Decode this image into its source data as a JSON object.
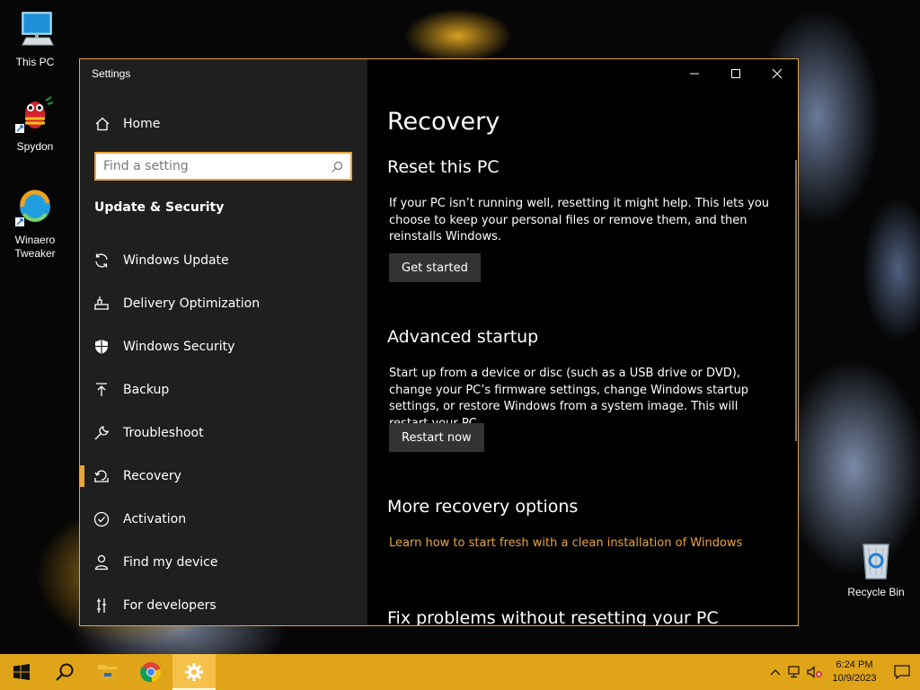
{
  "desktop": {
    "icons": [
      {
        "label": "This PC"
      },
      {
        "label": "Spydon"
      },
      {
        "label": "Winaero Tweaker"
      },
      {
        "label": "Recycle Bin"
      }
    ]
  },
  "window": {
    "title": "Settings",
    "controls": {
      "minimize": "minimize-icon",
      "maximize": "maximize-icon",
      "close": "close-icon"
    },
    "accent": "#e8a53c"
  },
  "sidebar": {
    "home_label": "Home",
    "search": {
      "placeholder": "Find a setting"
    },
    "section_title": "Update & Security",
    "items": [
      {
        "label": "Windows Update",
        "icon": "refresh-icon"
      },
      {
        "label": "Delivery Optimization",
        "icon": "delivery-optimization-icon"
      },
      {
        "label": "Windows Security",
        "icon": "shield-icon"
      },
      {
        "label": "Backup",
        "icon": "backup-arrow-icon"
      },
      {
        "label": "Troubleshoot",
        "icon": "wrench-icon"
      },
      {
        "label": "Recovery",
        "icon": "recovery-icon",
        "active": true
      },
      {
        "label": "Activation",
        "icon": "check-circle-icon"
      },
      {
        "label": "Find my device",
        "icon": "person-location-icon"
      },
      {
        "label": "For developers",
        "icon": "developer-tools-icon"
      }
    ]
  },
  "content": {
    "title": "Recovery",
    "reset": {
      "heading": "Reset this PC",
      "text": "If your PC isn’t running well, resetting it might help. This lets you choose to keep your personal files or remove them, and then reinstalls Windows.",
      "button": "Get started"
    },
    "advanced": {
      "heading": "Advanced startup",
      "text": "Start up from a device or disc (such as a USB drive or DVD), change your PC’s firmware settings, change Windows startup settings, or restore Windows from a system image. This will restart your PC.",
      "button": "Restart now"
    },
    "more": {
      "heading": "More recovery options",
      "link": "Learn how to start fresh with a clean installation of Windows"
    },
    "fix": {
      "heading": "Fix problems without resetting your PC"
    }
  },
  "taskbar": {
    "color": "#e0a418",
    "apps": [
      "start-icon",
      "search-icon",
      "file-explorer-icon",
      "chrome-icon",
      "settings-icon"
    ],
    "clock": {
      "time": "6:24 PM",
      "date": "10/9/2023"
    }
  }
}
